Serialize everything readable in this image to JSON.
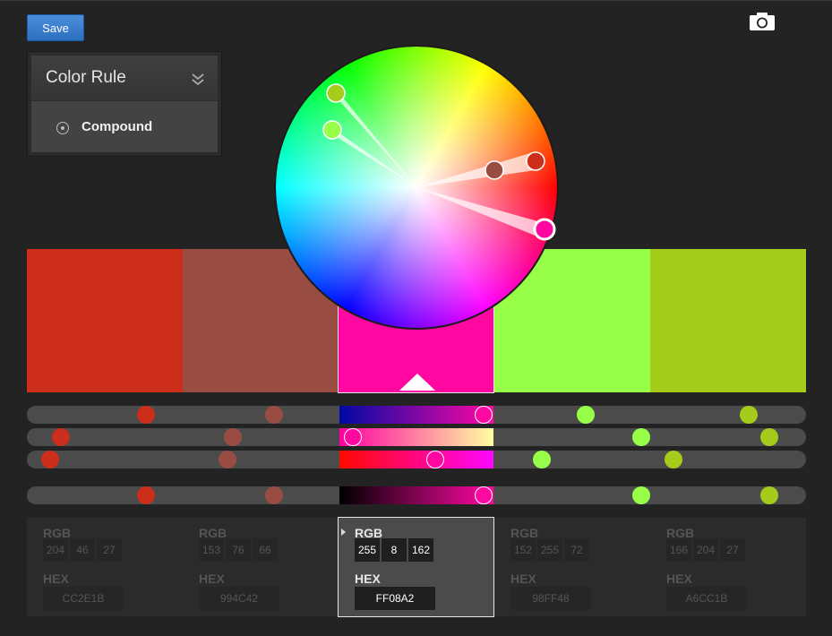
{
  "toolbar": {
    "save_label": "Save",
    "camera_icon": "camera-icon"
  },
  "color_rule": {
    "title": "Color Rule",
    "selected": "Compound"
  },
  "colors": [
    "#CC2E1B",
    "#994C42",
    "#FF08A2",
    "#98FF48",
    "#A6CC1B"
  ],
  "active_index": 2,
  "swatches": [
    {
      "hex": "CC2E1B",
      "rgb": [
        "204",
        "46",
        "27"
      ]
    },
    {
      "hex": "994C42",
      "rgb": [
        "153",
        "76",
        "66"
      ]
    },
    {
      "hex": "FF08A2",
      "rgb": [
        "255",
        "8",
        "162"
      ]
    },
    {
      "hex": "98FF48",
      "rgb": [
        "152",
        "255",
        "72"
      ]
    },
    {
      "hex": "A6CC1B",
      "rgb": [
        "166",
        "204",
        "27"
      ]
    }
  ],
  "labels": {
    "rgb": "RGB",
    "hex": "HEX"
  }
}
